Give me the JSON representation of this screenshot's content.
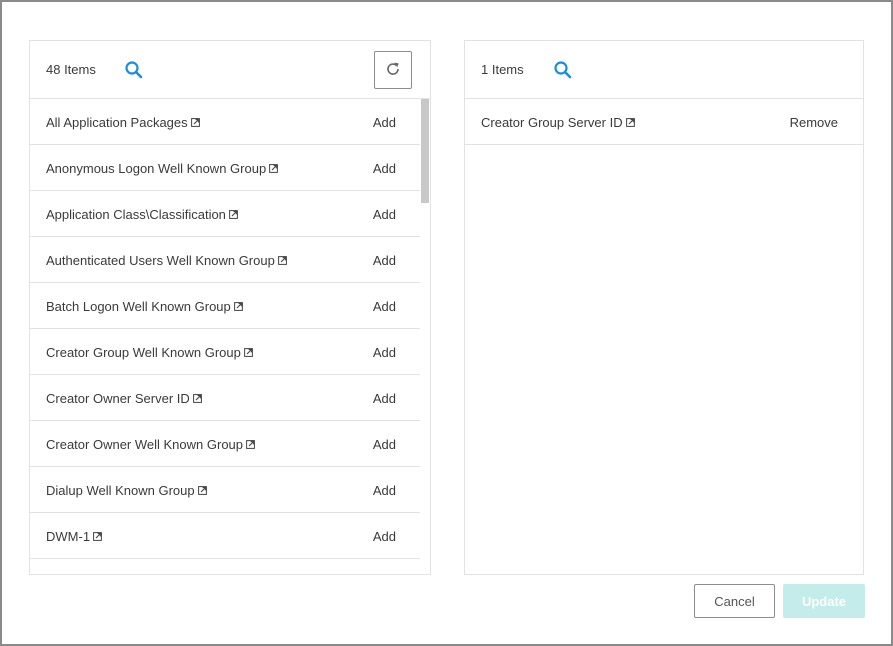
{
  "left_panel": {
    "count_label": "48 Items",
    "icons": {
      "search": "search-icon",
      "refresh": "refresh-icon",
      "external": "external-link-icon"
    },
    "items": [
      {
        "name": "All Application Packages",
        "action": "Add"
      },
      {
        "name": "Anonymous Logon Well Known Group",
        "action": "Add"
      },
      {
        "name": "Application Class\\Classification",
        "action": "Add"
      },
      {
        "name": "Authenticated Users Well Known Group",
        "action": "Add"
      },
      {
        "name": "Batch Logon Well Known Group",
        "action": "Add"
      },
      {
        "name": "Creator Group Well Known Group",
        "action": "Add"
      },
      {
        "name": "Creator Owner Server ID",
        "action": "Add"
      },
      {
        "name": "Creator Owner Well Known Group",
        "action": "Add"
      },
      {
        "name": "Dialup Well Known Group",
        "action": "Add"
      },
      {
        "name": "DWM-1",
        "action": "Add"
      }
    ]
  },
  "right_panel": {
    "count_label": "1 Items",
    "items": [
      {
        "name": "Creator Group Server ID",
        "action": "Remove"
      }
    ]
  },
  "footer": {
    "cancel_label": "Cancel",
    "update_label": "Update"
  },
  "colors": {
    "accent_blue": "#1a8fd8",
    "update_disabled_bg": "#c3ecea"
  }
}
